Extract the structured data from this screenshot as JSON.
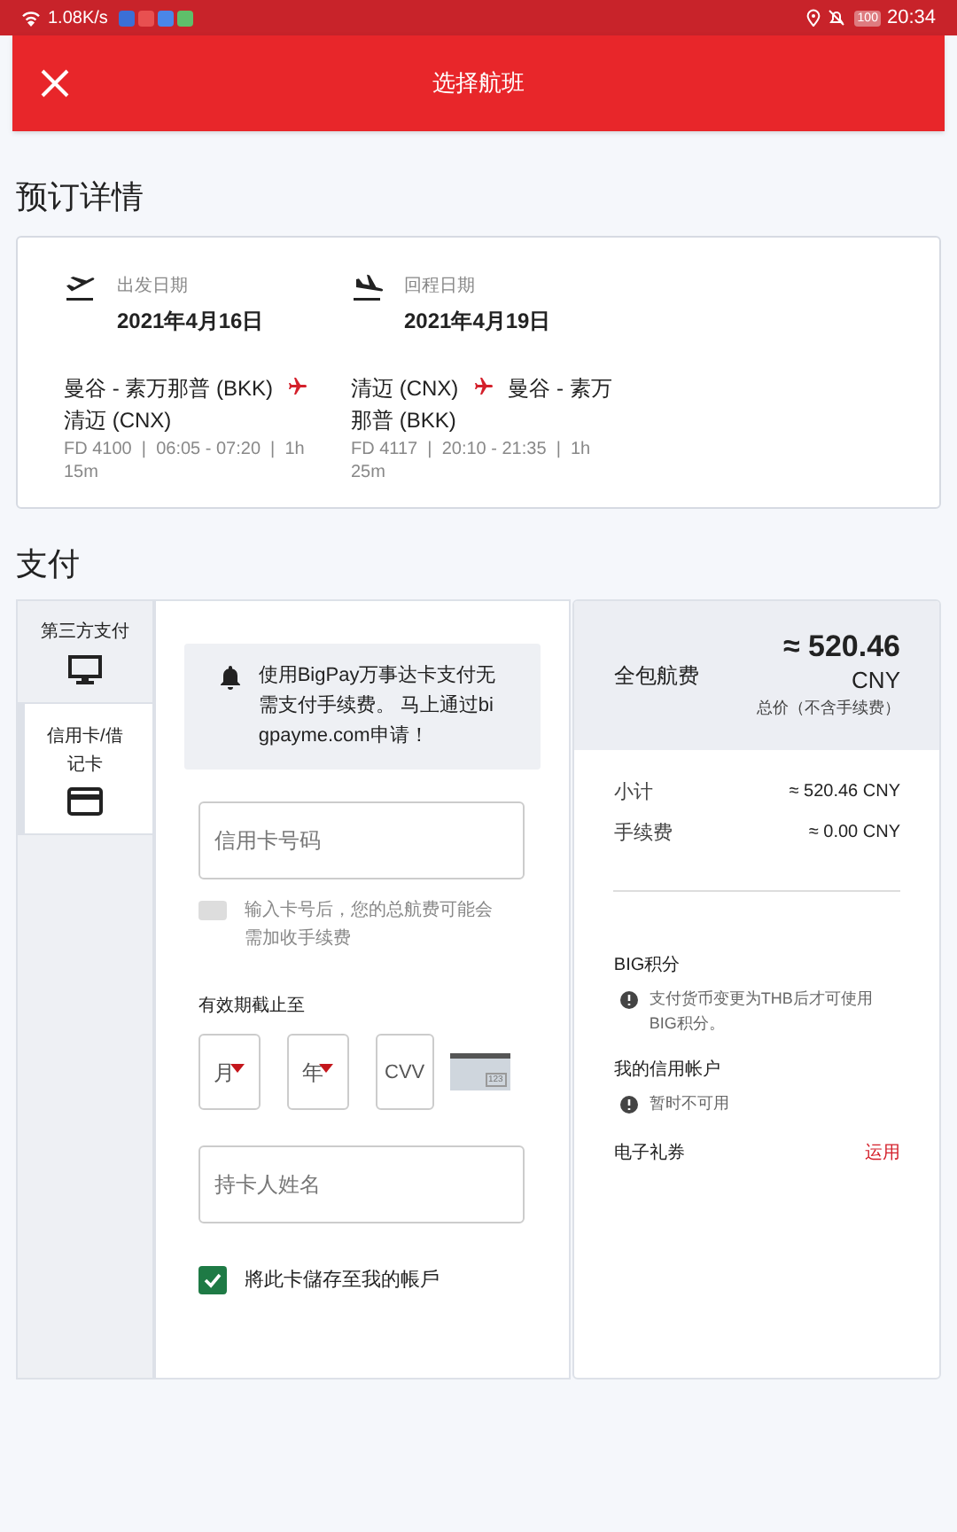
{
  "status_bar": {
    "speed": "1.08K/s",
    "battery": "100",
    "time": "20:34"
  },
  "header": {
    "title": "选择航班"
  },
  "booking": {
    "title": "预订详情",
    "legs": [
      {
        "kind": "depart",
        "label": "出发日期",
        "date": "2021年4月16日",
        "from": "曼谷 - 素万那普 (BKK)",
        "to": "清迈 (CNX)",
        "details": "FD 4100  |  06:05 - 07:20  |  1h 15m"
      },
      {
        "kind": "return",
        "label": "回程日期",
        "date": "2021年4月19日",
        "from": "清迈 (CNX)",
        "to": "曼谷 - 素万那普 (BKK)",
        "details": "FD 4117  |  20:10 - 21:35  |  1h 25m"
      }
    ]
  },
  "payment": {
    "title": "支付",
    "tabs": [
      {
        "label": "第三方支付",
        "kind": "monitor",
        "selected": false
      },
      {
        "label": "信用卡/借记卡",
        "kind": "card",
        "selected": true
      }
    ],
    "notice": "使用BigPay万事达卡支付无需支付手续费。 马上通过bigpayme.com申请！",
    "card_number": {
      "placeholder": "信用卡号码"
    },
    "fee_note": "输入卡号后，您的总航费可能会需加收手续费",
    "expiry_label": "有效期截止至",
    "month": {
      "placeholder": "月"
    },
    "year": {
      "placeholder": "年"
    },
    "cvv": {
      "placeholder": "CVV"
    },
    "card_hint": "123",
    "cardholder": {
      "placeholder": "持卡人姓名"
    },
    "save_card": {
      "label": "將此卡儲存至我的帳戶",
      "checked": true
    }
  },
  "summary": {
    "title": "全包航费",
    "total": "≈ 520.46",
    "currency": "CNY",
    "total_note": "总价（不含手续费）",
    "lines": [
      {
        "label": "小计",
        "value": "≈ 520.46 CNY"
      },
      {
        "label": "手续费",
        "value": "≈ 0.00 CNY"
      }
    ],
    "notes": [
      {
        "title": "BIG积分",
        "note": "支付货币变更为THB后才可使用BIG积分。"
      },
      {
        "title": "我的信用帐户",
        "note": "暂时不可用"
      }
    ],
    "voucher": {
      "title": "电子礼券",
      "action": "运用"
    }
  }
}
